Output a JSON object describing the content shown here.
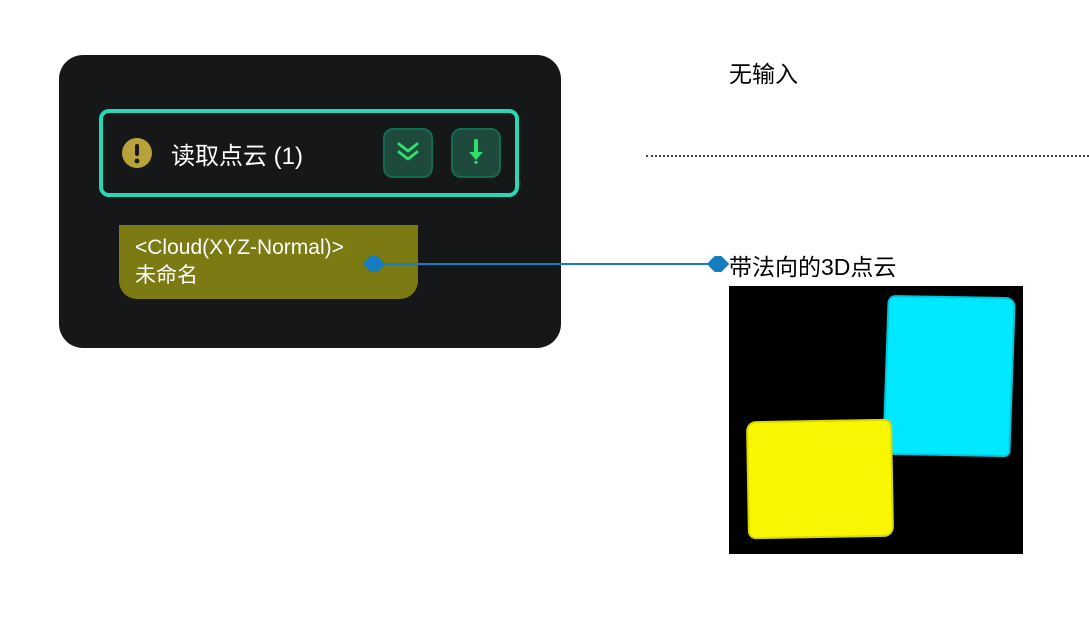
{
  "node": {
    "title": "读取点云 (1)",
    "status_icon": "warning-icon",
    "buttons": {
      "expand": "expand-down-icon",
      "execute": "execute-icon"
    },
    "output": {
      "type_label": "<Cloud(XYZ-Normal)>",
      "name_label": "未命名"
    }
  },
  "right": {
    "no_input_label": "无输入",
    "output_label": "带法向的3D点云"
  },
  "colors": {
    "node_bg": "#161719",
    "accent": "#29d7b4",
    "chip": "#7c7a13",
    "arrow_green": "#2fe06a",
    "connector": "#157dbf",
    "cyan_blob": "#00e8ff",
    "yellow_blob": "#f8f600"
  }
}
